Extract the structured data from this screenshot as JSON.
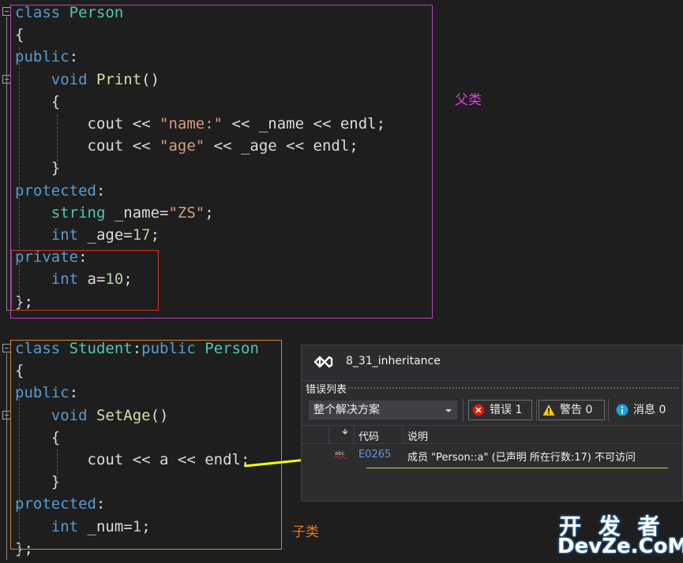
{
  "code_person": [
    [
      [
        "kw",
        "class "
      ],
      [
        "ty",
        "Person"
      ]
    ],
    [
      [
        "pl",
        "{"
      ]
    ],
    [
      [
        "kw",
        "public"
      ],
      [
        "pl",
        ":"
      ]
    ],
    [
      [
        "pl",
        "    "
      ],
      [
        "kw",
        "void "
      ],
      [
        "fn",
        "Print"
      ],
      [
        "pl",
        "()"
      ]
    ],
    [
      [
        "pl",
        "    {"
      ]
    ],
    [
      [
        "pl",
        "        cout << "
      ],
      [
        "st",
        "\"name:\""
      ],
      [
        "pl",
        " << _name << endl;"
      ]
    ],
    [
      [
        "pl",
        "        cout << "
      ],
      [
        "st",
        "\"age\""
      ],
      [
        "pl",
        " << _age << endl;"
      ]
    ],
    [
      [
        "pl",
        "    }"
      ]
    ],
    [
      [
        "kw",
        "protected"
      ],
      [
        "pl",
        ":"
      ]
    ],
    [
      [
        "pl",
        "    "
      ],
      [
        "ty",
        "string"
      ],
      [
        "pl",
        " _name="
      ],
      [
        "st",
        "\"ZS\""
      ],
      [
        "pl",
        ";"
      ]
    ],
    [
      [
        "pl",
        "    "
      ],
      [
        "kw",
        "int"
      ],
      [
        "pl",
        " _age="
      ],
      [
        "nm",
        "17"
      ],
      [
        "pl",
        ";"
      ]
    ],
    [
      [
        "kw",
        "private"
      ],
      [
        "pl",
        ":"
      ]
    ],
    [
      [
        "pl",
        "    "
      ],
      [
        "kw",
        "int"
      ],
      [
        "pl",
        " a="
      ],
      [
        "nm",
        "10"
      ],
      [
        "pl",
        ";"
      ]
    ],
    [
      [
        "pl",
        "};"
      ]
    ]
  ],
  "code_student": [
    [
      [
        "kw",
        "class "
      ],
      [
        "ty",
        "Student"
      ],
      [
        "pl",
        ":"
      ],
      [
        "kw",
        "public "
      ],
      [
        "ty",
        "Person"
      ]
    ],
    [
      [
        "pl",
        "{"
      ]
    ],
    [
      [
        "kw",
        "public"
      ],
      [
        "pl",
        ":"
      ]
    ],
    [
      [
        "pl",
        "    "
      ],
      [
        "kw",
        "void "
      ],
      [
        "fn",
        "SetAge"
      ],
      [
        "pl",
        "()"
      ]
    ],
    [
      [
        "pl",
        "    {"
      ]
    ],
    [
      [
        "pl",
        "        cout << a << endl;"
      ]
    ],
    [
      [
        "pl",
        "    }"
      ]
    ],
    [
      [
        "kw",
        "protected"
      ],
      [
        "pl",
        ":"
      ]
    ],
    [
      [
        "pl",
        "    "
      ],
      [
        "kw",
        "int"
      ],
      [
        "pl",
        " _num="
      ],
      [
        "nm",
        "1"
      ],
      [
        "pl",
        ";"
      ]
    ],
    [
      [
        "pl",
        "};"
      ]
    ]
  ],
  "annotations": {
    "parent_label": "父类",
    "child_label": "子类"
  },
  "error_list": {
    "project_title": "8_31_inheritance",
    "tool_title": "错误列表",
    "scope": "整个解决方案",
    "errors_label": "错误 1",
    "warnings_label": "警告 0",
    "messages_label": "消息 0",
    "col_code": "代码",
    "col_desc": "说明",
    "rows": [
      {
        "code": "E0265",
        "desc": "成员 \"Person::a\" (已声明 所在行数:17) 不可访问"
      }
    ]
  },
  "watermark": {
    "top_text": "开 发 者",
    "bottom_text": "DevZe.CoM"
  },
  "colors": {
    "keyword": "#569cd6",
    "type": "#4ec9b0",
    "function": "#dcdcaa",
    "string": "#d69d85",
    "number": "#b5cea8",
    "plain": "#dcdcdc",
    "parent_box": "#c23fbf",
    "private_box": "#d1352a",
    "child_box": "#d0843a",
    "arrow": "#ffff00",
    "watermark": "#3a8fd8"
  }
}
